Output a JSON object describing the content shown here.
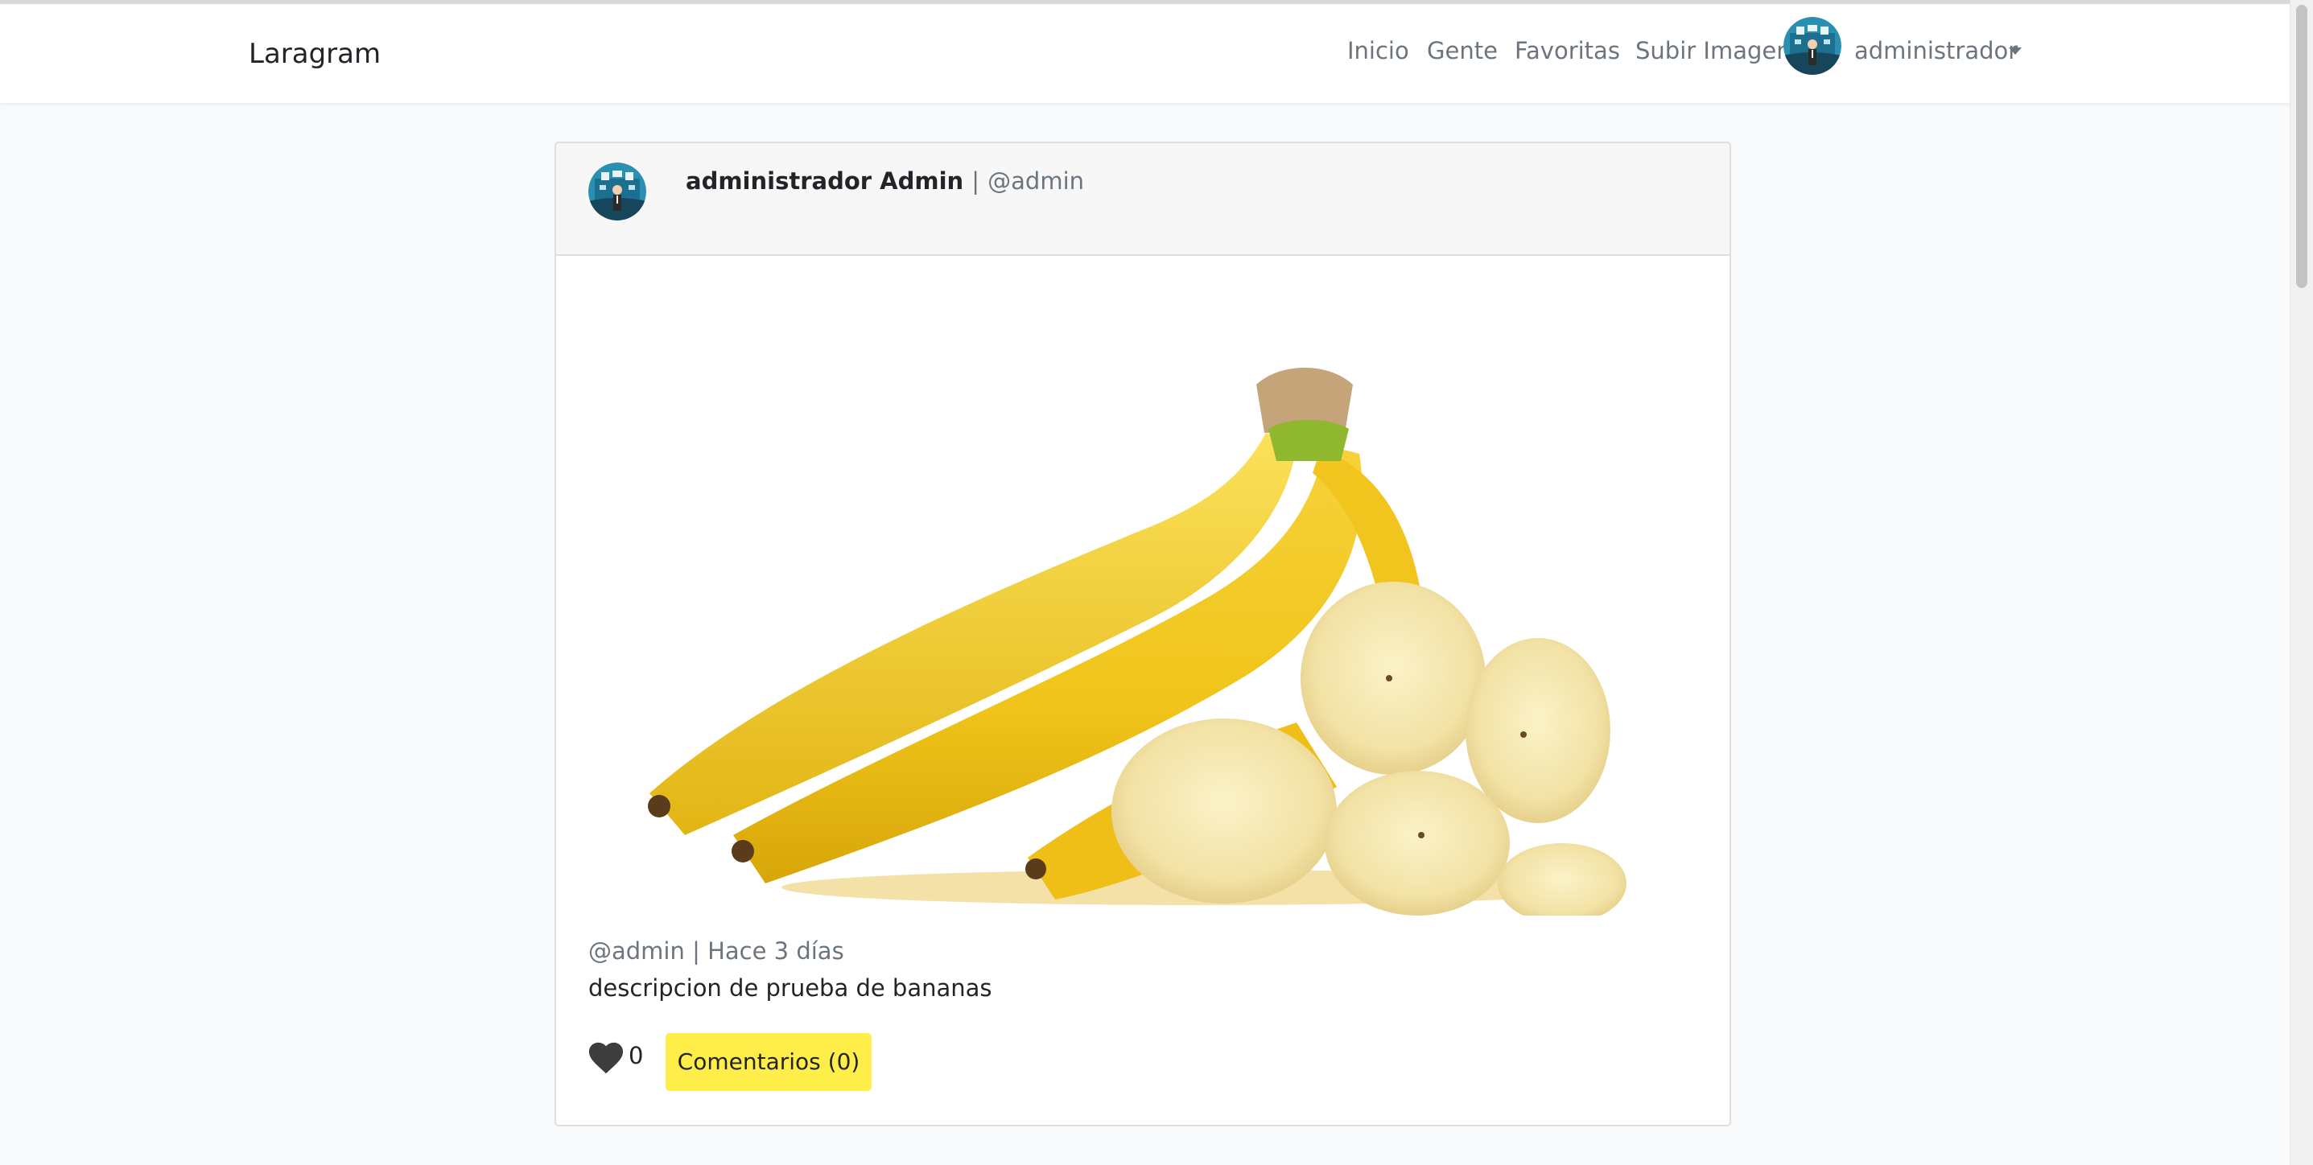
{
  "navbar": {
    "brand": "Laragram",
    "links": [
      "Inicio",
      "Gente",
      "Favoritas",
      "Subir Imagen"
    ],
    "user_label": "administrador"
  },
  "post": {
    "author_name": "administrador Admin",
    "separator": "|",
    "author_nick": "@admin",
    "meta_nick": "@admin",
    "meta_time": "Hace 3 días",
    "description": "descripcion de prueba de bananas",
    "likes": "0",
    "comments_label": "Comentarios (0)"
  },
  "colors": {
    "accent": "#ffed4a",
    "heart": "#3d3d3d",
    "muted": "#6c757d",
    "background": "#f8fafc"
  }
}
